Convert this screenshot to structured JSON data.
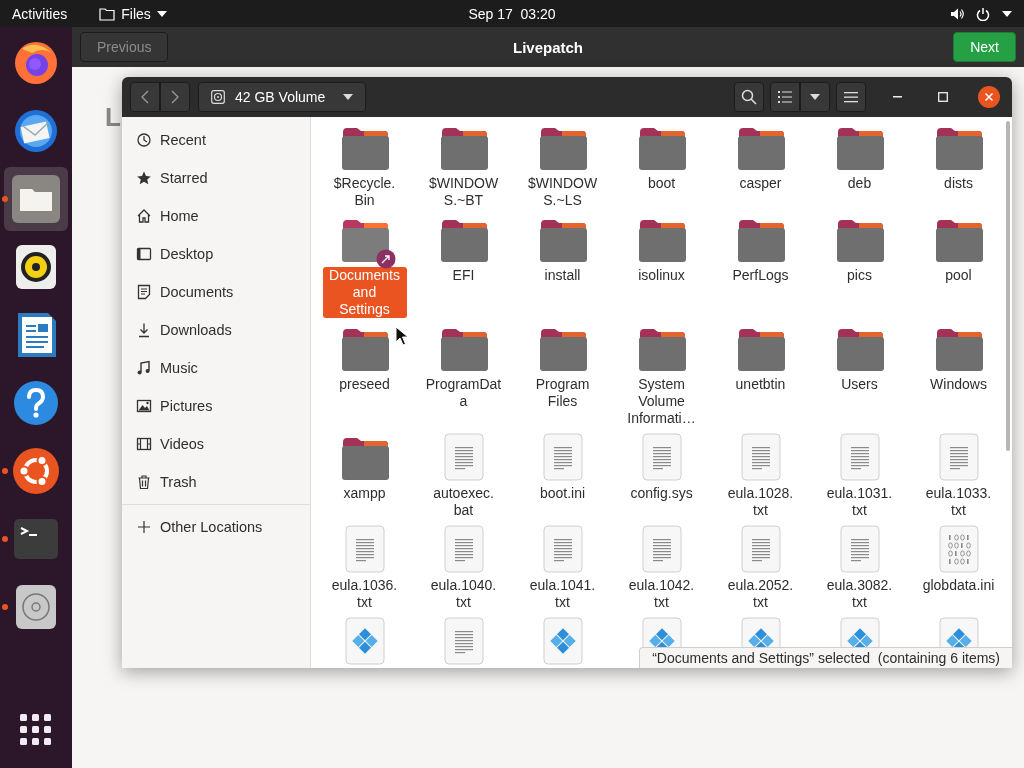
{
  "top_bar": {
    "activities": "Activities",
    "app_menu": "Files",
    "clock": "Sep 17  03:20"
  },
  "dock": {
    "items": [
      {
        "running": false,
        "selected": false
      },
      {
        "running": false,
        "selected": false
      },
      {
        "running": true,
        "selected": true
      },
      {
        "running": false,
        "selected": false
      },
      {
        "running": false,
        "selected": false
      },
      {
        "running": false,
        "selected": false
      },
      {
        "running": true,
        "selected": false
      },
      {
        "running": true,
        "selected": false
      },
      {
        "running": true,
        "selected": false
      }
    ]
  },
  "installer": {
    "previous": {
      "label": "Previous",
      "disabled": true
    },
    "title": "Livepatch",
    "next": {
      "label": "Next"
    },
    "heading": "L"
  },
  "files_window": {
    "location": "42 GB Volume",
    "sidebar": {
      "items": [
        "Recent",
        "Starred",
        "Home",
        "Desktop",
        "Documents",
        "Downloads",
        "Music",
        "Pictures",
        "Videos",
        "Trash"
      ],
      "other": "Other Locations"
    },
    "items": [
      {
        "name": "$Recycle.Bin",
        "kind": "folder",
        "selected": false,
        "link": false
      },
      {
        "name": "$WINDOWS.~BT",
        "kind": "folder",
        "selected": false,
        "link": false
      },
      {
        "name": "$WINDOWS.~LS",
        "kind": "folder",
        "selected": false,
        "link": false
      },
      {
        "name": "boot",
        "kind": "folder",
        "selected": false,
        "link": false
      },
      {
        "name": "casper",
        "kind": "folder",
        "selected": false,
        "link": false
      },
      {
        "name": "deb",
        "kind": "folder",
        "selected": false,
        "link": false
      },
      {
        "name": "dists",
        "kind": "folder",
        "selected": false,
        "link": false
      },
      {
        "name": "Documents and Settings",
        "kind": "folder",
        "selected": true,
        "link": true
      },
      {
        "name": "EFI",
        "kind": "folder",
        "selected": false,
        "link": false
      },
      {
        "name": "install",
        "kind": "folder",
        "selected": false,
        "link": false
      },
      {
        "name": "isolinux",
        "kind": "folder",
        "selected": false,
        "link": false
      },
      {
        "name": "PerfLogs",
        "kind": "folder",
        "selected": false,
        "link": false
      },
      {
        "name": "pics",
        "kind": "folder",
        "selected": false,
        "link": false
      },
      {
        "name": "pool",
        "kind": "folder",
        "selected": false,
        "link": false
      },
      {
        "name": "preseed",
        "kind": "folder",
        "selected": false,
        "link": false
      },
      {
        "name": "ProgramData",
        "kind": "folder",
        "selected": false,
        "link": false
      },
      {
        "name": "Program Files",
        "kind": "folder",
        "selected": false,
        "link": false
      },
      {
        "name": "System Volume Informati…",
        "kind": "folder",
        "selected": false,
        "link": false
      },
      {
        "name": "unetbtin",
        "kind": "folder",
        "selected": false,
        "link": false
      },
      {
        "name": "Users",
        "kind": "folder",
        "selected": false,
        "link": false
      },
      {
        "name": "Windows",
        "kind": "folder",
        "selected": false,
        "link": false
      },
      {
        "name": "xampp",
        "kind": "folder",
        "selected": false,
        "link": false
      },
      {
        "name": "autoexec.bat",
        "kind": "text",
        "selected": false,
        "link": false
      },
      {
        "name": "boot.ini",
        "kind": "text",
        "selected": false,
        "link": false
      },
      {
        "name": "config.sys",
        "kind": "text",
        "selected": false,
        "link": false
      },
      {
        "name": "eula.1028.txt",
        "kind": "text",
        "selected": false,
        "link": false
      },
      {
        "name": "eula.1031.txt",
        "kind": "text",
        "selected": false,
        "link": false
      },
      {
        "name": "eula.1033.txt",
        "kind": "text",
        "selected": false,
        "link": false
      },
      {
        "name": "eula.1036.txt",
        "kind": "text",
        "selected": false,
        "link": false
      },
      {
        "name": "eula.1040.txt",
        "kind": "text",
        "selected": false,
        "link": false
      },
      {
        "name": "eula.1041.txt",
        "kind": "text",
        "selected": false,
        "link": false
      },
      {
        "name": "eula.1042.txt",
        "kind": "text",
        "selected": false,
        "link": false
      },
      {
        "name": "eula.2052.txt",
        "kind": "text",
        "selected": false,
        "link": false
      },
      {
        "name": "eula.3082.txt",
        "kind": "text",
        "selected": false,
        "link": false
      },
      {
        "name": "globdata.ini",
        "kind": "binary",
        "selected": false,
        "link": false
      },
      {
        "kind": "package",
        "selected": false,
        "link": false
      },
      {
        "kind": "text",
        "selected": false,
        "link": false
      },
      {
        "kind": "package",
        "selected": false,
        "link": false
      },
      {
        "kind": "package",
        "selected": false
      },
      {
        "kind": "package",
        "selected": false
      },
      {
        "kind": "package",
        "selected": false
      },
      {
        "kind": "package",
        "selected": false
      }
    ],
    "status": "“Documents and Settings” selected  (containing 6 items)"
  }
}
